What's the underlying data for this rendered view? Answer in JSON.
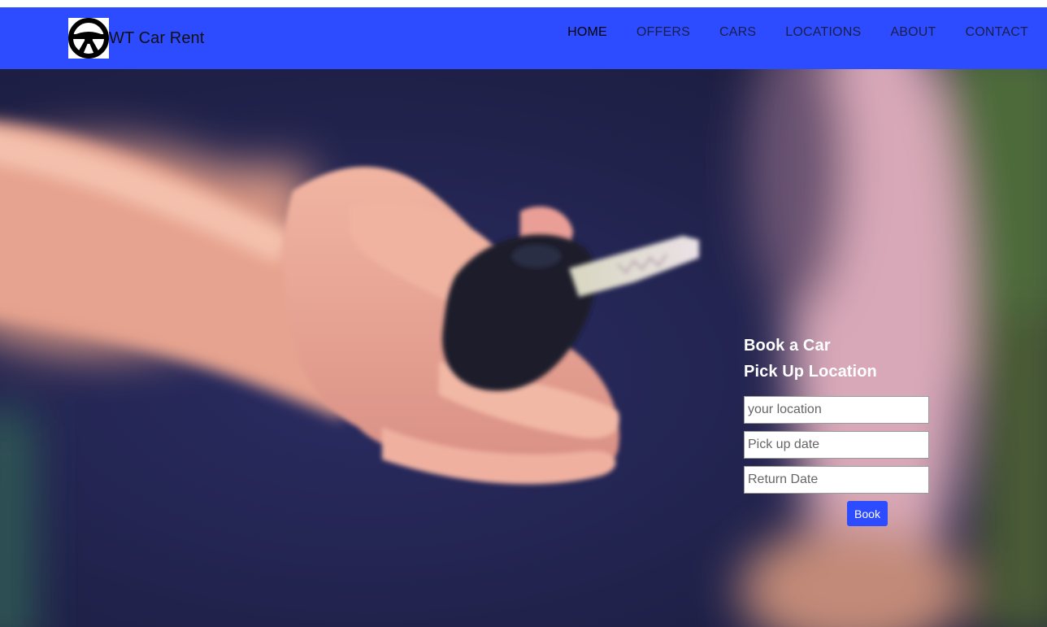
{
  "header": {
    "brand": "WT Car Rent",
    "logo_icon": "steering-wheel-icon",
    "background": "#2e4cff",
    "nav": [
      {
        "label": "HOME",
        "active": true
      },
      {
        "label": "OFFERS",
        "active": false
      },
      {
        "label": "CARS",
        "active": false
      },
      {
        "label": "LOCATIONS",
        "active": false
      },
      {
        "label": "ABOUT",
        "active": false
      },
      {
        "label": "CONTACT",
        "active": false
      }
    ]
  },
  "hero": {
    "image": "hand-holding-car-key"
  },
  "booking": {
    "title": "Book a Car",
    "subtitle": "Pick Up Location",
    "location_placeholder": "your location",
    "pickup_placeholder": "Pick up date",
    "return_placeholder": "Return Date",
    "button_label": "Book"
  }
}
